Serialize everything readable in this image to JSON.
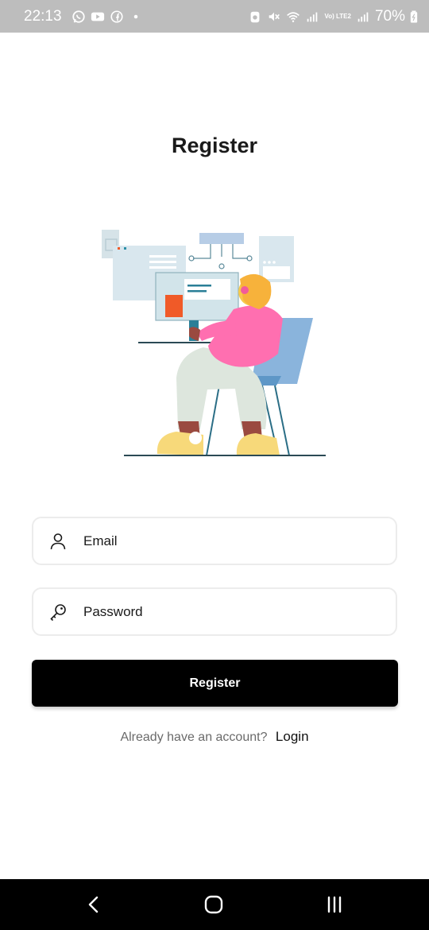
{
  "status_bar": {
    "time": "22:13",
    "network_tag": "Vo) LTE2",
    "battery_percent": "70%",
    "icons": [
      "whatsapp-icon",
      "youtube-icon",
      "facebook-icon",
      "dot-icon",
      "alarm-icon",
      "mute-icon",
      "wifi-icon",
      "signal-icon",
      "signal-icon",
      "battery-icon"
    ]
  },
  "page": {
    "title": "Register"
  },
  "form": {
    "email_placeholder": "Email",
    "password_placeholder": "Password",
    "email_icon": "user-icon",
    "password_icon": "key-icon",
    "submit_label": "Register"
  },
  "footer": {
    "prompt": "Already have an account?",
    "login_label": "Login"
  },
  "nav_bar": {
    "icons": [
      "back-icon",
      "home-icon",
      "recent-apps-icon"
    ]
  }
}
